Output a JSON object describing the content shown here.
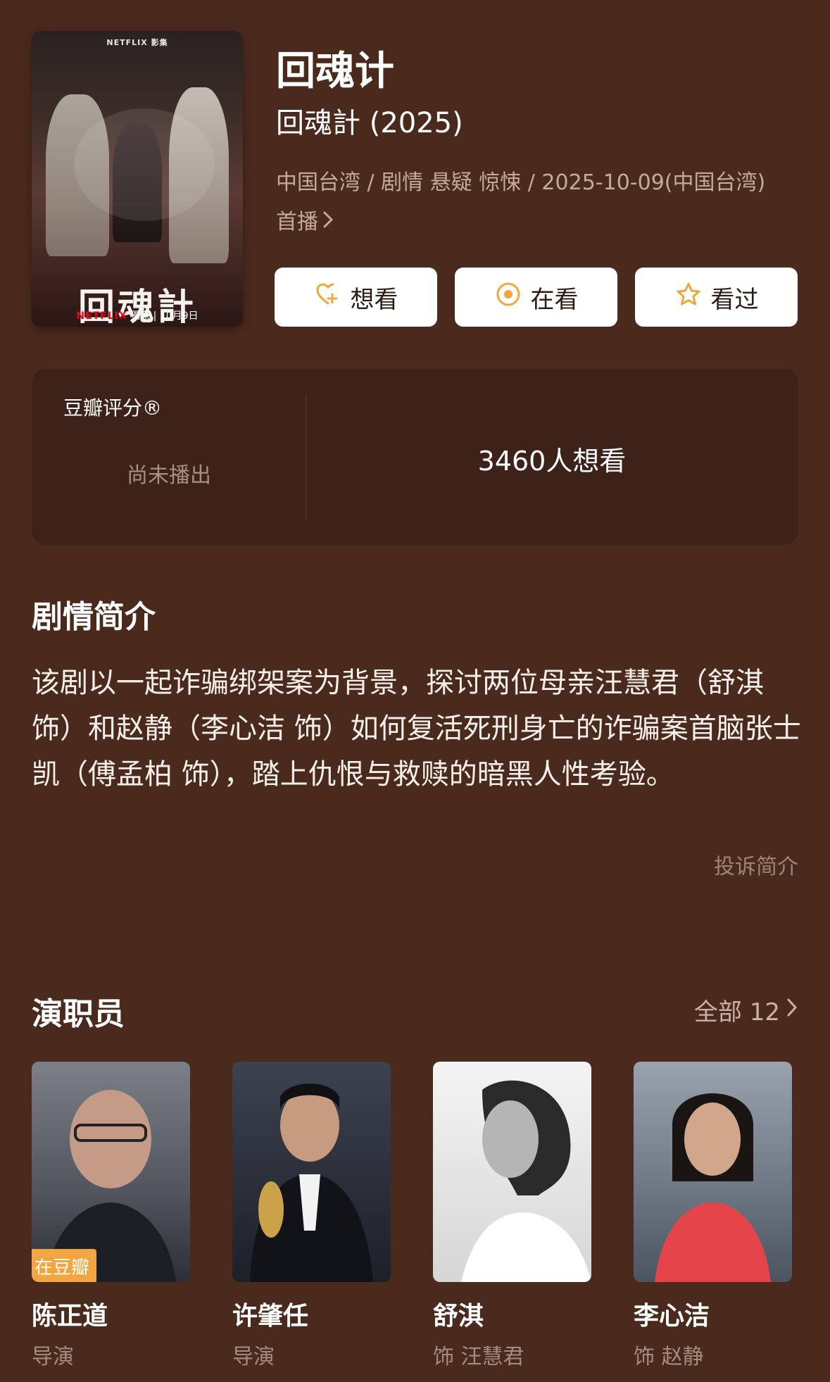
{
  "poster": {
    "brand_top": "NETFLIX 影集",
    "title_art": "回魂計",
    "brand_bottom": "NETFLIX",
    "exclusive": "獨家",
    "date": "10月9日"
  },
  "title": "回魂计",
  "subtitle": "回魂計 (2025)",
  "meta": "中国台湾 / 剧情 悬疑 惊悚 / 2025-10-09(中国台湾) 首播",
  "buttons": [
    {
      "label": "想看",
      "icon": "heart-plus-icon"
    },
    {
      "label": "在看",
      "icon": "target-icon"
    },
    {
      "label": "看过",
      "icon": "star-icon"
    }
  ],
  "rating": {
    "label": "豆瓣评分®",
    "status": "尚未播出",
    "want_count": "3460人想看"
  },
  "synopsis": {
    "title": "剧情简介",
    "text": "该剧以一起诈骗绑架案为背景，探讨两位母亲汪慧君（舒淇 饰）和赵静（李心洁 饰）如何复活死刑身亡的诈骗案首脑张士凯（傅孟柏 饰），踏上仇恨与救赎的暗黑人性考验。",
    "report": "投诉简介"
  },
  "cast": {
    "title": "演职员",
    "all_label": "全部 12",
    "members": [
      {
        "name": "陈正道",
        "role": "导演",
        "badge": "在豆瓣"
      },
      {
        "name": "许肇任",
        "role": "导演"
      },
      {
        "name": "舒淇",
        "role": "饰 汪慧君"
      },
      {
        "name": "李心洁",
        "role": "饰 赵静"
      }
    ]
  },
  "colors": {
    "background": "#4b2a1e",
    "card": "#3e2219",
    "accent": "#f3a640"
  }
}
